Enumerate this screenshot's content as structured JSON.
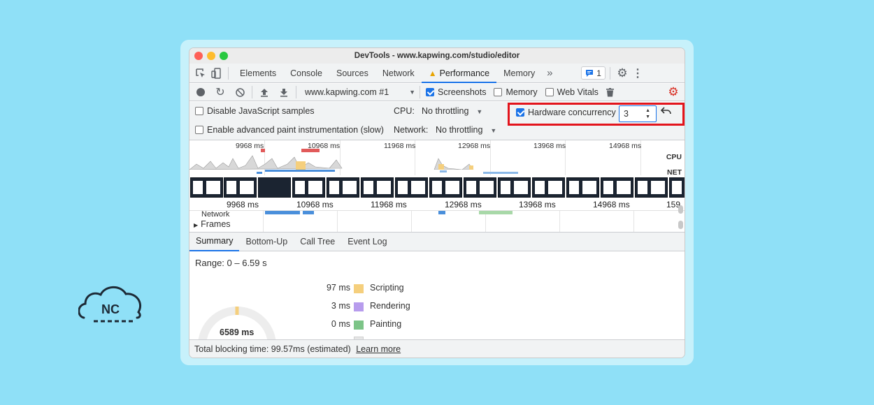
{
  "window_title": "DevTools - www.kapwing.com/studio/editor",
  "tabs": [
    "Elements",
    "Console",
    "Sources",
    "Network",
    "Performance",
    "Memory"
  ],
  "active_tab": "Performance",
  "issues_count": "1",
  "toolbar": {
    "profile_select": "www.kapwing.com #1",
    "screenshots_label": "Screenshots",
    "screenshots_checked": true,
    "memory_label": "Memory",
    "memory_checked": false,
    "webvitals_label": "Web Vitals",
    "webvitals_checked": false
  },
  "settings": {
    "disable_js_label": "Disable JavaScript samples",
    "paint_label": "Enable advanced paint instrumentation (slow)",
    "cpu_label": "CPU:",
    "cpu_value": "No throttling",
    "network_label": "Network:",
    "network_value": "No throttling",
    "hw_label": "Hardware concurrency",
    "hw_checked": true,
    "hw_value": "3"
  },
  "overview": {
    "ticks": [
      "9968 ms",
      "10968 ms",
      "11968 ms",
      "12968 ms",
      "13968 ms",
      "14968 ms"
    ],
    "cpu_label": "CPU",
    "net_label": "NET"
  },
  "timeline_ticks": [
    "9968 ms",
    "10968 ms",
    "11968 ms",
    "12968 ms",
    "13968 ms",
    "14968 ms",
    "159"
  ],
  "tracks": {
    "network": "Network",
    "frames": "Frames"
  },
  "subtabs": [
    "Summary",
    "Bottom-Up",
    "Call Tree",
    "Event Log"
  ],
  "summary": {
    "range": "Range: 0 – 6.59 s",
    "total": "6589 ms",
    "legend": [
      {
        "value": "97 ms",
        "label": "Scripting",
        "color": "#f5cf7d"
      },
      {
        "value": "3 ms",
        "label": "Rendering",
        "color": "#b79ced"
      },
      {
        "value": "0 ms",
        "label": "Painting",
        "color": "#7cc487"
      }
    ]
  },
  "footer": {
    "text": "Total blocking time: 99.57ms (estimated)",
    "link": "Learn more"
  },
  "brand": {
    "logo_text": "NC"
  }
}
